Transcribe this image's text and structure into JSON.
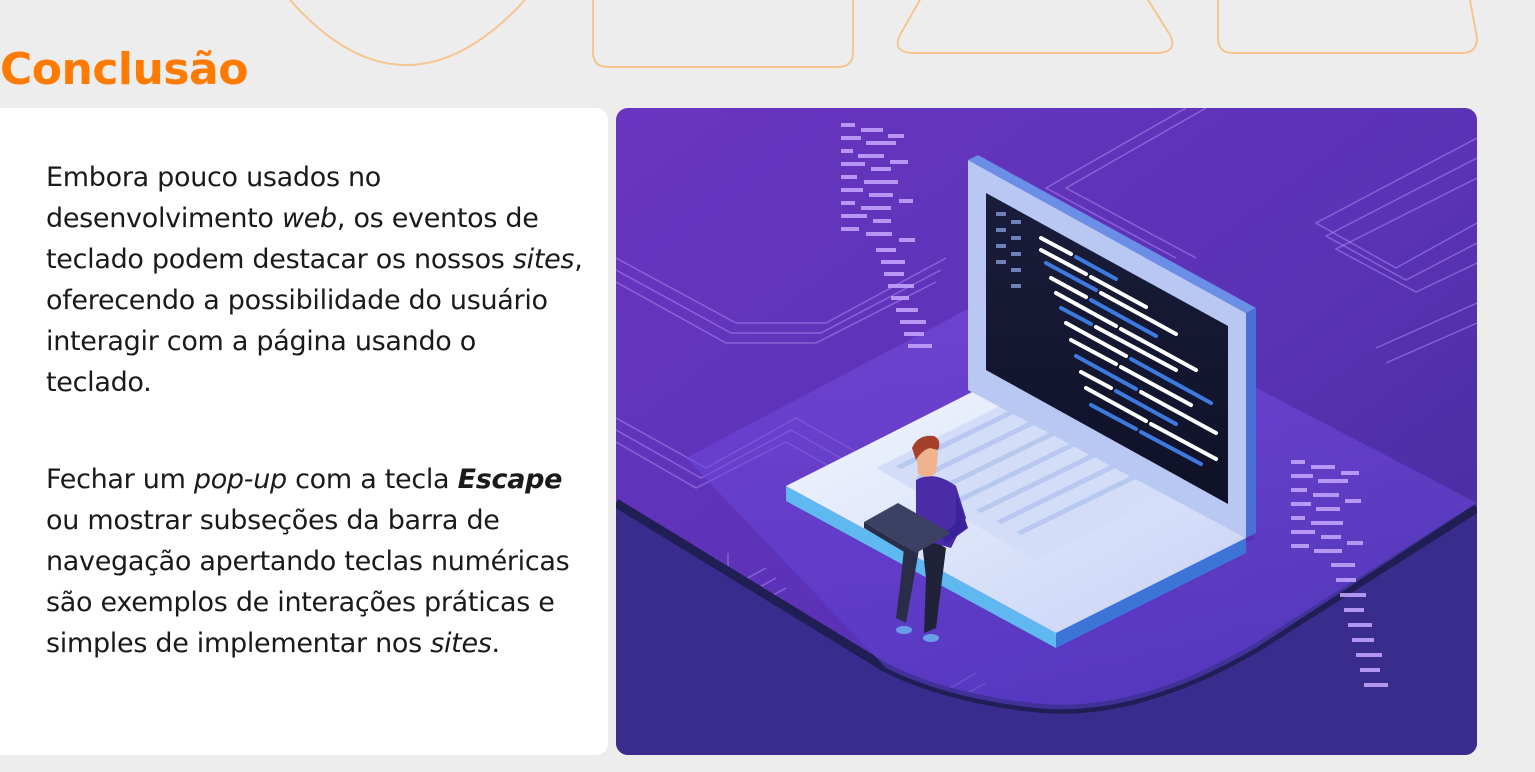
{
  "header": {
    "title": "Conclusão"
  },
  "content": {
    "paragraph1": {
      "t1": "Embora pouco usados no desenvolvimento ",
      "t2": "web",
      "t3": ", os eventos de teclado podem destacar os nossos ",
      "t4": "sites",
      "t5": ", oferecendo a possibilidade do usuário interagir com a página usando o teclado."
    },
    "paragraph2": {
      "t1": "Fechar um ",
      "t2": "pop-up",
      "t3": " com a tecla ",
      "t4": "Escape",
      "t5": " ou mostrar subseções da barra de navegação apertando teclas numéricas são exemplos de interações práticas e simples de implementar nos ",
      "t6": "sites",
      "t7": "."
    }
  },
  "illustration": {
    "subject": "person-with-laptop-coding",
    "colors": {
      "background_top": "#6a35c0",
      "background_bottom": "#3a2a8a",
      "accent": "#ff7a00"
    }
  }
}
